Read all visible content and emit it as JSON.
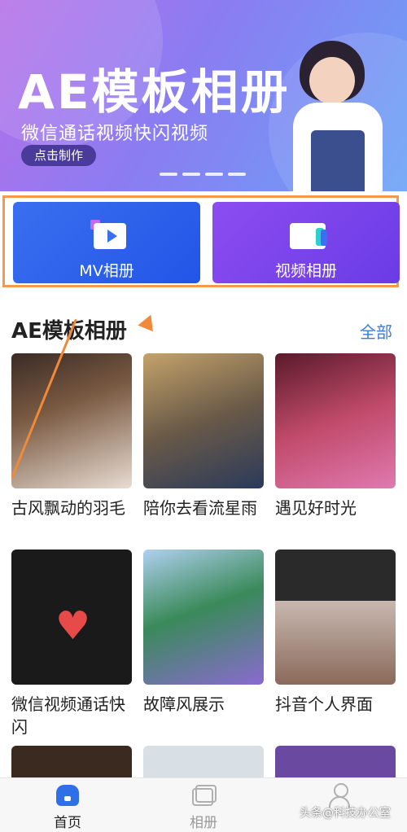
{
  "banner": {
    "title": "AE模板相册",
    "subtitle": "微信通话视频快闪视频",
    "button": "点击制作"
  },
  "quick_actions": [
    {
      "label": "MV相册"
    },
    {
      "label": "视频相册"
    }
  ],
  "section": {
    "title": "AE模板相册",
    "all_label": "全部"
  },
  "templates": [
    {
      "name": "古风飘动的羽毛"
    },
    {
      "name": "陪你去看流星雨"
    },
    {
      "name": "遇见好时光"
    },
    {
      "name": "微信视频通话快闪"
    },
    {
      "name": "故障风展示"
    },
    {
      "name": "抖音个人界面"
    }
  ],
  "tabbar": {
    "home": "首页",
    "albums": "相册"
  },
  "watermark": "头条@科技办公室",
  "colors": {
    "accent": "#2f6fe8",
    "highlight_border": "#f59a4d",
    "section_link": "#3a7be6"
  }
}
